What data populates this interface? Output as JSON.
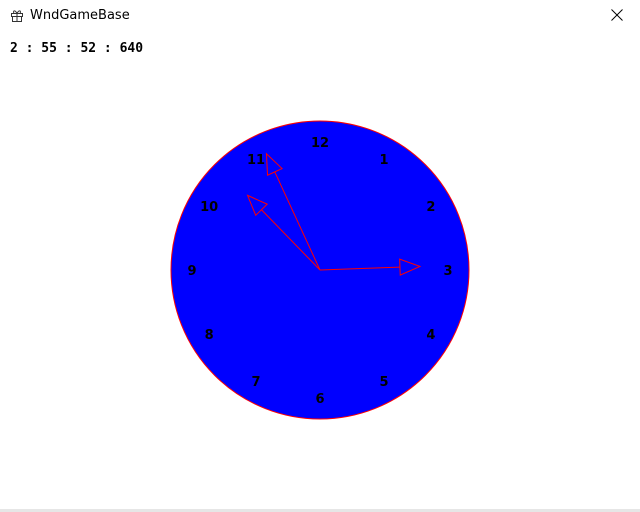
{
  "window": {
    "title": "WndGameBase",
    "app_icon": "gift-icon",
    "close_icon": "close-icon"
  },
  "clock": {
    "time_text": "2 : 55 : 52 : 640",
    "hour": 2,
    "minute": 55,
    "second": 52,
    "millisecond": 640,
    "numerals": [
      "12",
      "1",
      "2",
      "3",
      "4",
      "5",
      "6",
      "7",
      "8",
      "9",
      "10",
      "11"
    ],
    "face_color": "#0000ff",
    "outline_color": "#ff0000",
    "hand_color": "#ff0000",
    "numeral_color": "#000000"
  }
}
